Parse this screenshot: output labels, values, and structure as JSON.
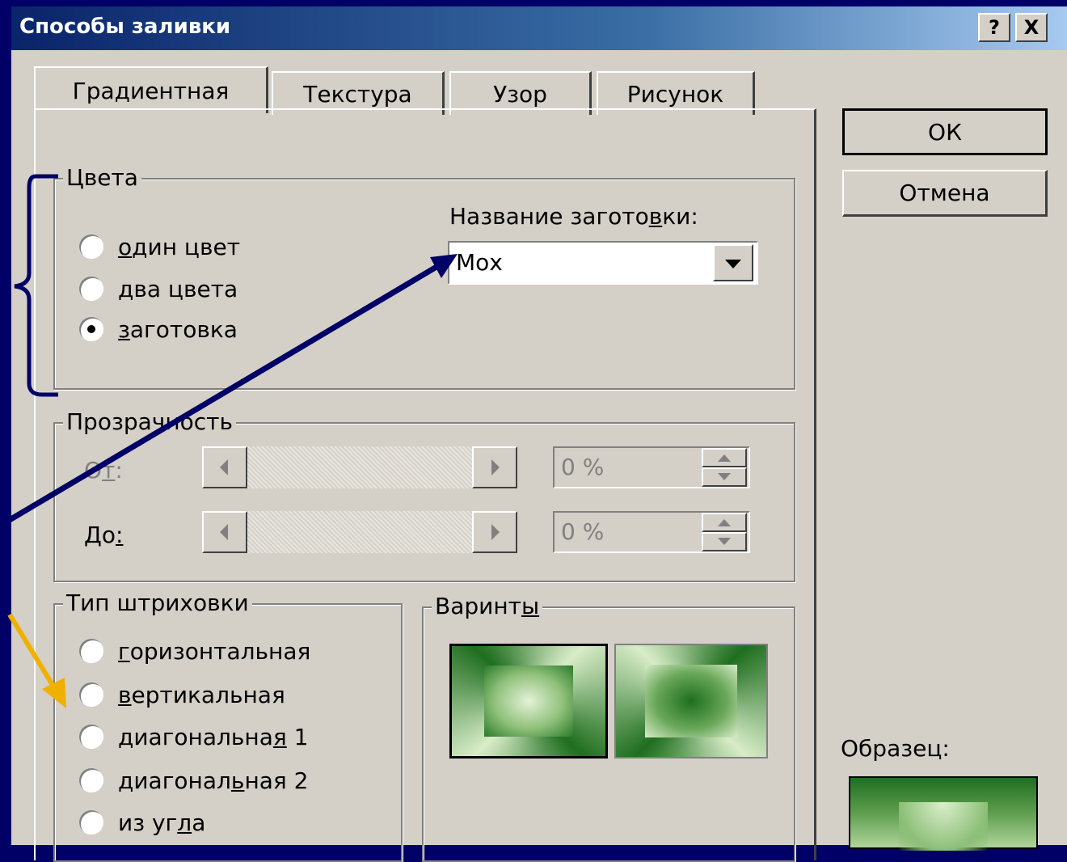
{
  "window": {
    "title": "Способы заливки",
    "help_label": "?",
    "close_label": "X"
  },
  "tabs": [
    {
      "label": "Градиентная",
      "active": true
    },
    {
      "label": "Текстура",
      "active": false
    },
    {
      "label": "Узор",
      "active": false
    },
    {
      "label": "Рисунок",
      "active": false
    }
  ],
  "buttons": {
    "ok": "ОК",
    "cancel": "Отмена"
  },
  "colors_group": {
    "legend": "Цвета",
    "radios": [
      {
        "pre": "",
        "acc": "о",
        "post": "дин цвет",
        "checked": false
      },
      {
        "pre": "",
        "acc": "д",
        "post": "ва цвета",
        "checked": false
      },
      {
        "pre": "",
        "acc": "з",
        "post": "аготовка",
        "checked": true
      }
    ],
    "preset": {
      "label_pre": "Название загото",
      "label_acc": "в",
      "label_post": "ки:",
      "value": "Мох"
    }
  },
  "transparency": {
    "legend": "Прозрачность",
    "from": {
      "pre": "О",
      "acc": "т",
      "post": ":",
      "value": "0 %"
    },
    "to": {
      "pre": "До",
      "acc": ":",
      "post": "",
      "value": "0 %"
    }
  },
  "hatch": {
    "legend": "Тип штриховки",
    "radios": [
      {
        "pre": "",
        "acc": "г",
        "post": "оризонтальная"
      },
      {
        "pre": "",
        "acc": "в",
        "post": "ертикальная"
      },
      {
        "pre": "диагональна",
        "acc": "я",
        "post": " 1"
      },
      {
        "pre": "диагонал",
        "acc": "ь",
        "post": "ная 2"
      },
      {
        "pre": "из уг",
        "acc": "л",
        "post": "а"
      }
    ]
  },
  "variants": {
    "legend_pre": "Варинт",
    "legend_acc": "ы"
  },
  "sample": {
    "label": "Образец:"
  },
  "palette": {
    "dark_green": "#1f6e1f",
    "light_green": "#d0e8c0",
    "arrow_navy": "#000066",
    "arrow_gold": "#f0b000"
  }
}
